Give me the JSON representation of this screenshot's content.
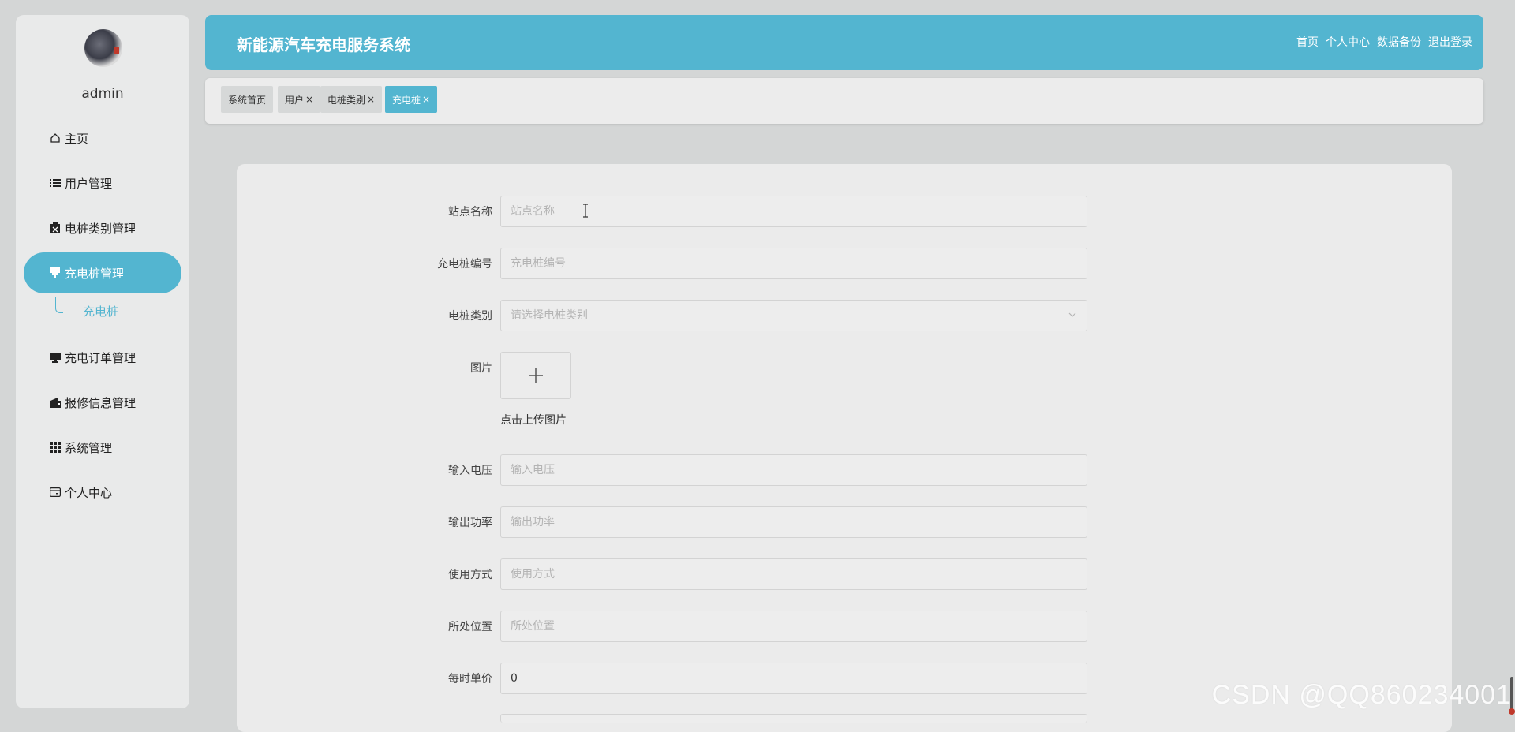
{
  "header": {
    "title": "新能源汽车充电服务系统",
    "nav": [
      "首页",
      "个人中心",
      "数据备份",
      "退出登录"
    ]
  },
  "sidebar": {
    "username": "admin",
    "items": [
      {
        "label": "主页",
        "icon": "home-icon"
      },
      {
        "label": "用户管理",
        "icon": "list-icon"
      },
      {
        "label": "电桩类别管理",
        "icon": "clipboard-icon"
      },
      {
        "label": "充电桩管理",
        "icon": "plug-icon"
      },
      {
        "label": "充电订单管理",
        "icon": "monitor-icon"
      },
      {
        "label": "报修信息管理",
        "icon": "wallet-icon"
      },
      {
        "label": "系统管理",
        "icon": "grid-icon"
      },
      {
        "label": "个人中心",
        "icon": "card-icon"
      }
    ],
    "submenu": {
      "label": "充电桩"
    }
  },
  "tabs": [
    {
      "label": "系统首页",
      "closable": false
    },
    {
      "label": "用户",
      "closable": true
    },
    {
      "label": "电桩类别",
      "closable": true
    },
    {
      "label": "充电桩",
      "closable": true,
      "active": true
    }
  ],
  "tab_close": "×",
  "form": {
    "station_name": {
      "label": "站点名称",
      "placeholder": "站点名称"
    },
    "pile_number": {
      "label": "充电桩编号",
      "placeholder": "充电桩编号"
    },
    "pile_type": {
      "label": "电桩类别",
      "placeholder": "请选择电桩类别"
    },
    "image": {
      "label": "图片",
      "tip": "点击上传图片"
    },
    "input_voltage": {
      "label": "输入电压",
      "placeholder": "输入电压"
    },
    "output_power": {
      "label": "输出功率",
      "placeholder": "输出功率"
    },
    "usage": {
      "label": "使用方式",
      "placeholder": "使用方式"
    },
    "location": {
      "label": "所处位置",
      "placeholder": "所处位置"
    },
    "unit_price": {
      "label": "每时单价",
      "value": "0"
    }
  },
  "watermark": "CSDN @QQ860234001",
  "colors": {
    "accent": "#53b5d0",
    "background": "#d4d6d6"
  }
}
